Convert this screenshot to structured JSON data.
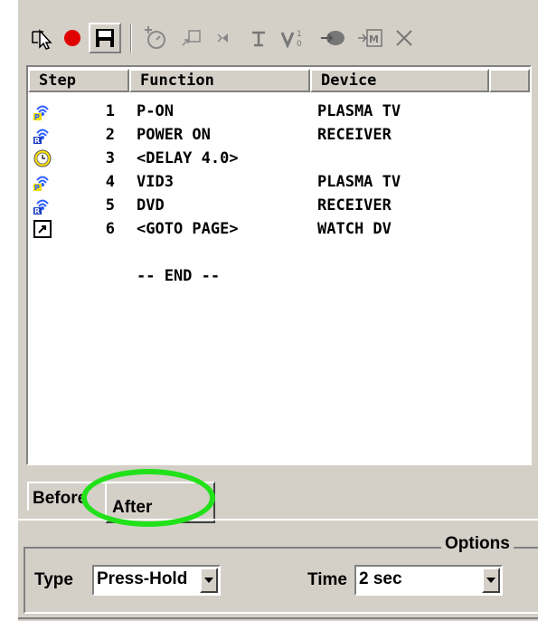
{
  "toolbar": {
    "icons": [
      "pointer-icon",
      "record-icon",
      "save-icon",
      "add-ir-icon",
      "jump-icon",
      "sound-icon",
      "text-icon",
      "variable-icon",
      "device-icon",
      "macro-icon",
      "delete-icon"
    ]
  },
  "list": {
    "headers": {
      "step": "Step",
      "function": "Function",
      "device": "Device"
    },
    "rows": [
      {
        "icon": "ir-signal-icon-p",
        "step": "1",
        "function": "P-ON",
        "device": "PLASMA TV"
      },
      {
        "icon": "ir-signal-icon-r",
        "step": "2",
        "function": "POWER ON",
        "device": "RECEIVER"
      },
      {
        "icon": "clock-icon",
        "step": "3",
        "function": "<DELAY 4.0>",
        "device": ""
      },
      {
        "icon": "ir-signal-icon-p",
        "step": "4",
        "function": "VID3",
        "device": "PLASMA TV"
      },
      {
        "icon": "ir-signal-icon-r",
        "step": "5",
        "function": "DVD",
        "device": "RECEIVER"
      },
      {
        "icon": "goto-icon",
        "step": "6",
        "function": "<GOTO PAGE>",
        "device": "WATCH DV"
      }
    ],
    "end_marker": "-- END --"
  },
  "tabs": {
    "before": "Before",
    "after": "After"
  },
  "options": {
    "label": "Options",
    "type_label": "Type",
    "type_value": "Press-Hold",
    "time_label": "Time",
    "time_value": "2 sec"
  },
  "colors": {
    "panel": "#d4d0c8",
    "highlight": "#22e11a",
    "record": "#e00000"
  }
}
